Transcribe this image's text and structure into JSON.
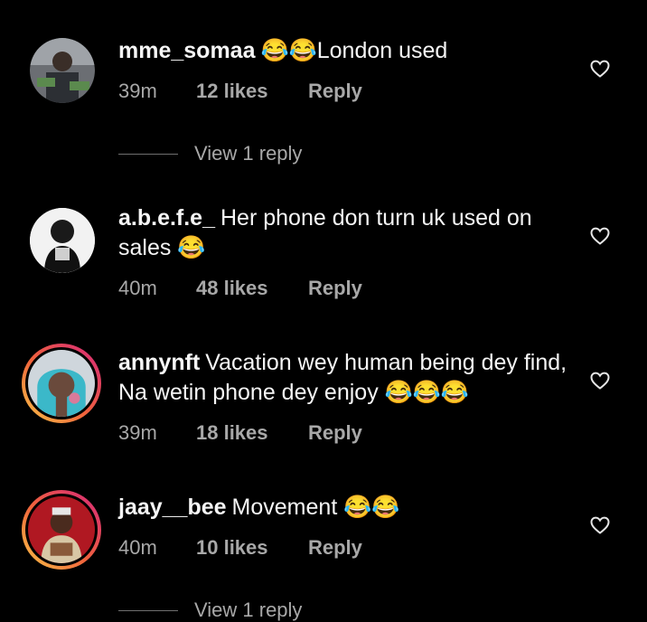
{
  "comments": [
    {
      "username": "mme_somaa",
      "text": "😂😂London used",
      "time": "39m",
      "likes": "12 likes",
      "reply": "Reply",
      "view_replies": "View 1 reply"
    },
    {
      "username": "a.b.e.f.e_",
      "text": "Her phone don turn uk used on sales 😂",
      "time": "40m",
      "likes": "48 likes",
      "reply": "Reply"
    },
    {
      "username": "annynft",
      "text": "Vacation wey human being dey find, Na wetin phone dey enjoy 😂😂😂",
      "time": "39m",
      "likes": "18 likes",
      "reply": "Reply"
    },
    {
      "username": "jaay__bee",
      "text": "Movement 😂😂",
      "time": "40m",
      "likes": "10 likes",
      "reply": "Reply",
      "view_replies": "View 1 reply"
    }
  ],
  "colors": {
    "background": "#000000",
    "primary_text": "#f5f5f5",
    "secondary_text": "#a8a8a8",
    "story_ring_start": "#f9c647",
    "story_ring_end": "#d6267b"
  }
}
